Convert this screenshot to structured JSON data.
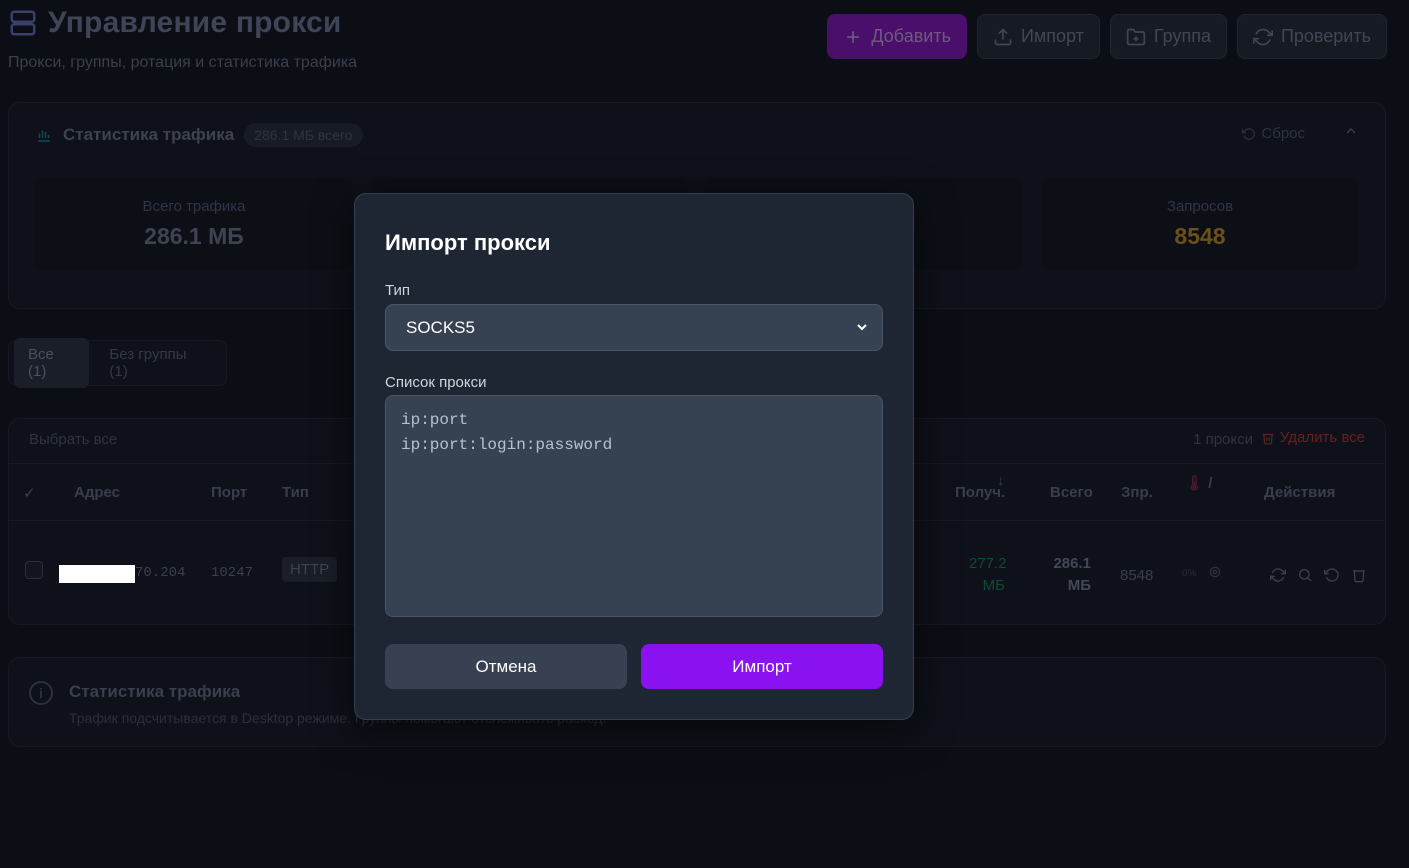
{
  "header": {
    "title": "Управление прокси",
    "subtitle": "Прокси, группы, ротация и статистика трафика",
    "actions": {
      "add": "Добавить",
      "import": "Импорт",
      "group": "Группа",
      "check": "Проверить"
    }
  },
  "stats": {
    "title": "Статистика трафика",
    "total_badge": "286.1 МБ всего",
    "reset": "Сброс",
    "boxes": [
      {
        "label": "Всего трафика",
        "value": "286.1 МБ"
      },
      {
        "label": "Запросов",
        "value": "8548"
      }
    ]
  },
  "tabs": [
    {
      "label": "Все (1)"
    },
    {
      "label": "Без группы (1)"
    }
  ],
  "table": {
    "select_all": "Выбрать все",
    "count": "1 прокси",
    "delete_all": "Удалить все",
    "columns": {
      "check": "✓",
      "address": "Адрес",
      "port": "Порт",
      "type": "Тип",
      "received_arrow": "↓",
      "received": "Получ.",
      "total": "Всего",
      "requests": "Зпр.",
      "rotation": "/",
      "actions": "Действия"
    },
    "row": {
      "address_suffix": "70.204",
      "port": "10247",
      "type": "HTTP",
      "received_value": "277.2",
      "received_unit": "МБ",
      "total_value": "286.1",
      "total_unit": "МБ",
      "requests": "8548",
      "rotation_pct": "0%"
    }
  },
  "info": {
    "title": "Статистика трафика",
    "text": "Трафик подсчитывается в Desktop режиме. Группы помогают отслеживать расход."
  },
  "modal": {
    "title": "Импорт прокси",
    "type_label": "Тип",
    "type_value": "SOCKS5",
    "list_label": "Список прокси",
    "list_line1": "ip:port",
    "list_line2": "ip:port:login:password",
    "cancel": "Отмена",
    "confirm": "Импорт"
  },
  "colors": {
    "accent": "#8a12f0",
    "gold": "#f59e0b",
    "green": "#10b981",
    "danger": "#ef4444"
  }
}
